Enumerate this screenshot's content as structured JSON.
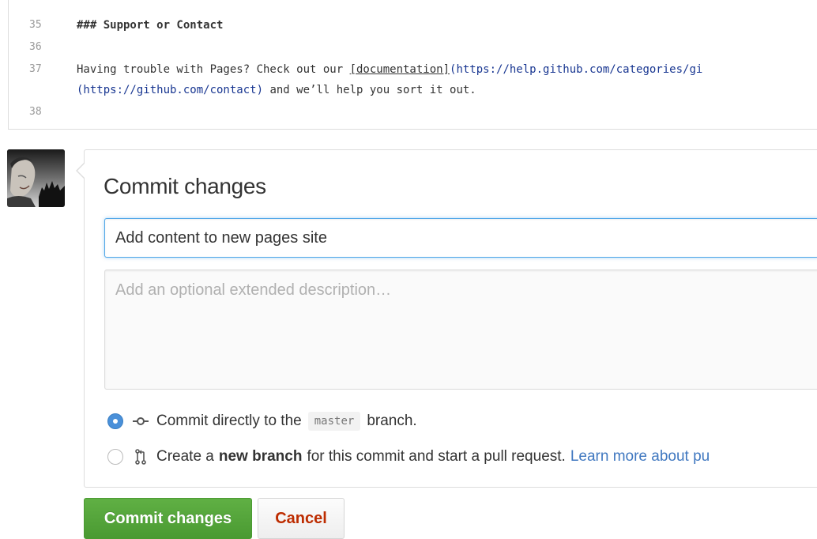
{
  "editor": {
    "lines": [
      {
        "num": "35",
        "text": "### Support or Contact"
      },
      {
        "num": "36",
        "text": ""
      },
      {
        "num": "37",
        "prefix": "Having trouble with Pages? Check out our ",
        "link_text": "[documentation]",
        "url": "(https://help.github.com/categories/gi",
        "cont_url": "(https://github.com/contact)",
        "cont_suffix": " and we’ll help you sort it out."
      },
      {
        "num": "38",
        "text": ""
      }
    ]
  },
  "commit": {
    "title": "Commit changes",
    "summary_value": "Add content to new pages site",
    "description_placeholder": "Add an optional extended description…",
    "option_direct": {
      "prefix": "Commit directly to the",
      "branch": "master",
      "suffix": "branch."
    },
    "option_new_branch": {
      "prefix": "Create a",
      "bold": "new branch",
      "middle": "for this commit and start a pull request.",
      "link": "Learn more about pu"
    },
    "submit_label": "Commit changes",
    "cancel_label": "Cancel"
  },
  "colors": {
    "primary_green": "#60b044",
    "cancel_red": "#bd2c00",
    "link_blue": "#4078c0",
    "focus_blue": "#51a7e8",
    "url_blue": "#183691"
  },
  "icons": [
    "git-commit-icon",
    "git-pull-request-icon",
    "avatar"
  ]
}
